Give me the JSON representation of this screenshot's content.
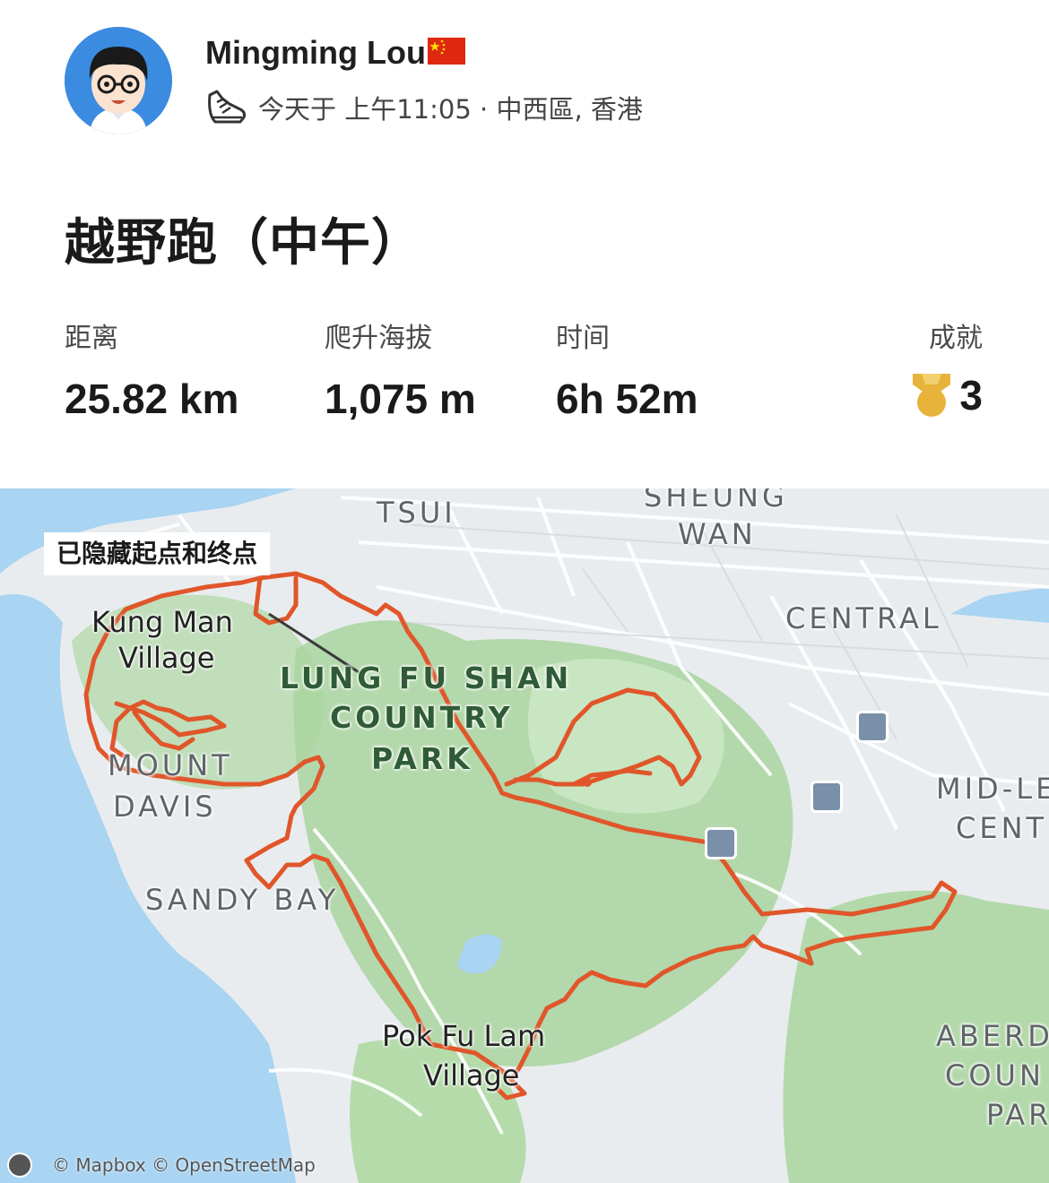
{
  "athlete": {
    "name": "Mingming Lou",
    "flag": "🇨🇳",
    "avatar": "avatar-cartoon",
    "activity_icon": "running-shoe-icon",
    "time_location": "今天于 上午11:05 · 中西區, 香港"
  },
  "activity": {
    "title": "越野跑（中午）"
  },
  "stats": [
    {
      "label": "距离",
      "value": "25.82 km"
    },
    {
      "label": "爬升海拔",
      "value": "1,075 m"
    },
    {
      "label": "时间",
      "value": "6h 52m"
    }
  ],
  "achievements": {
    "label": "成就",
    "count": "3",
    "icon": "medal-icon",
    "color": "#e8b33a"
  },
  "map": {
    "privacy_notice": "已隐藏起点和终点",
    "route_color": "#e0562a",
    "labels": {
      "tsui": "TSUI",
      "sheung": "SHEUNG",
      "wan": "WAN",
      "central": "CENTRAL",
      "kung_man": "Kung Man",
      "village": "Village",
      "lung_fu_shan": "LUNG FU SHAN",
      "country": "COUNTRY",
      "park": "PARK",
      "mount": "MOUNT",
      "davis": "DAVIS",
      "sandy_bay": "SANDY BAY",
      "mid_le": "MID-LE",
      "cent": "CENT",
      "pok_fu_lam": "Pok Fu Lam",
      "pok_village": "Village",
      "aberd": "ABERD",
      "coun": "COUN",
      "par": "PAR"
    },
    "attribution": "© Mapbox © OpenStreetMap"
  }
}
